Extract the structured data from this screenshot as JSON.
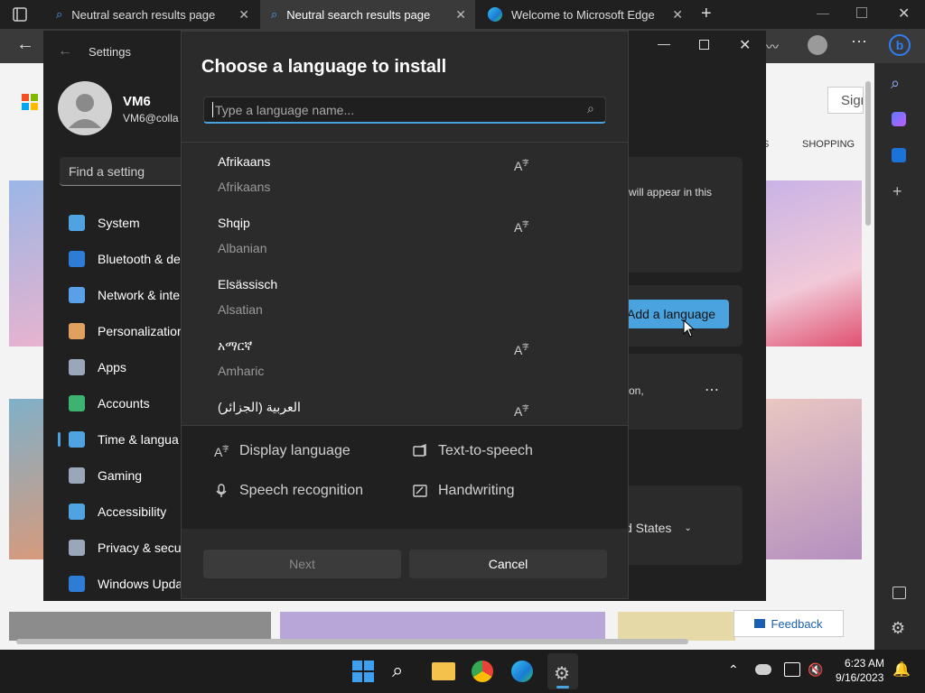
{
  "browser": {
    "tabs": [
      {
        "title": "Neutral search results page"
      },
      {
        "title": "Neutral search results page"
      },
      {
        "title": "Welcome to Microsoft Edge"
      }
    ],
    "page_snippets": {
      "sign_in": "Sign",
      "shopping": "SHOPPING",
      "tab_s": "S",
      "feedback": "Feedback"
    }
  },
  "settings": {
    "back_title": "Settings",
    "user_name": "VM6",
    "user_email": "VM6@colla",
    "search_placeholder": "Find a setting",
    "nav": [
      {
        "label": "System",
        "color": "#4fa3e0"
      },
      {
        "label": "Bluetooth & de",
        "color": "#2d7cd6"
      },
      {
        "label": "Network & inte",
        "color": "#5aa0e8"
      },
      {
        "label": "Personalization",
        "color": "#e0a060"
      },
      {
        "label": "Apps",
        "color": "#9aa7b8"
      },
      {
        "label": "Accounts",
        "color": "#3cb371"
      },
      {
        "label": "Time & langua",
        "color": "#4fa3e0"
      },
      {
        "label": "Gaming",
        "color": "#9aa7b8"
      },
      {
        "label": "Accessibility",
        "color": "#4fa3e0"
      },
      {
        "label": "Privacy & secu",
        "color": "#9aa7b8"
      },
      {
        "label": "Windows Upda",
        "color": "#2d7cd6"
      }
    ],
    "bg_text": {
      "appear": "will appear in this",
      "add_language": "Add a language",
      "on": "on,",
      "region": "d States"
    }
  },
  "dialog": {
    "title": "Choose a language to install",
    "search_placeholder": "Type a language name...",
    "languages": [
      {
        "native": "Afrikaans",
        "english": "Afrikaans",
        "has_display": true
      },
      {
        "native": "Shqip",
        "english": "Albanian",
        "has_display": true
      },
      {
        "native": "Elsässisch",
        "english": "Alsatian",
        "has_display": false
      },
      {
        "native": "አማርኛ",
        "english": "Amharic",
        "has_display": true
      },
      {
        "native": "العربية (الجزائر)",
        "english": "",
        "has_display": true
      }
    ],
    "features": {
      "display_language": "Display language",
      "text_to_speech": "Text-to-speech",
      "speech_recognition": "Speech recognition",
      "handwriting": "Handwriting"
    },
    "next_label": "Next",
    "cancel_label": "Cancel"
  },
  "taskbar": {
    "time": "6:23 AM",
    "date": "9/16/2023"
  }
}
